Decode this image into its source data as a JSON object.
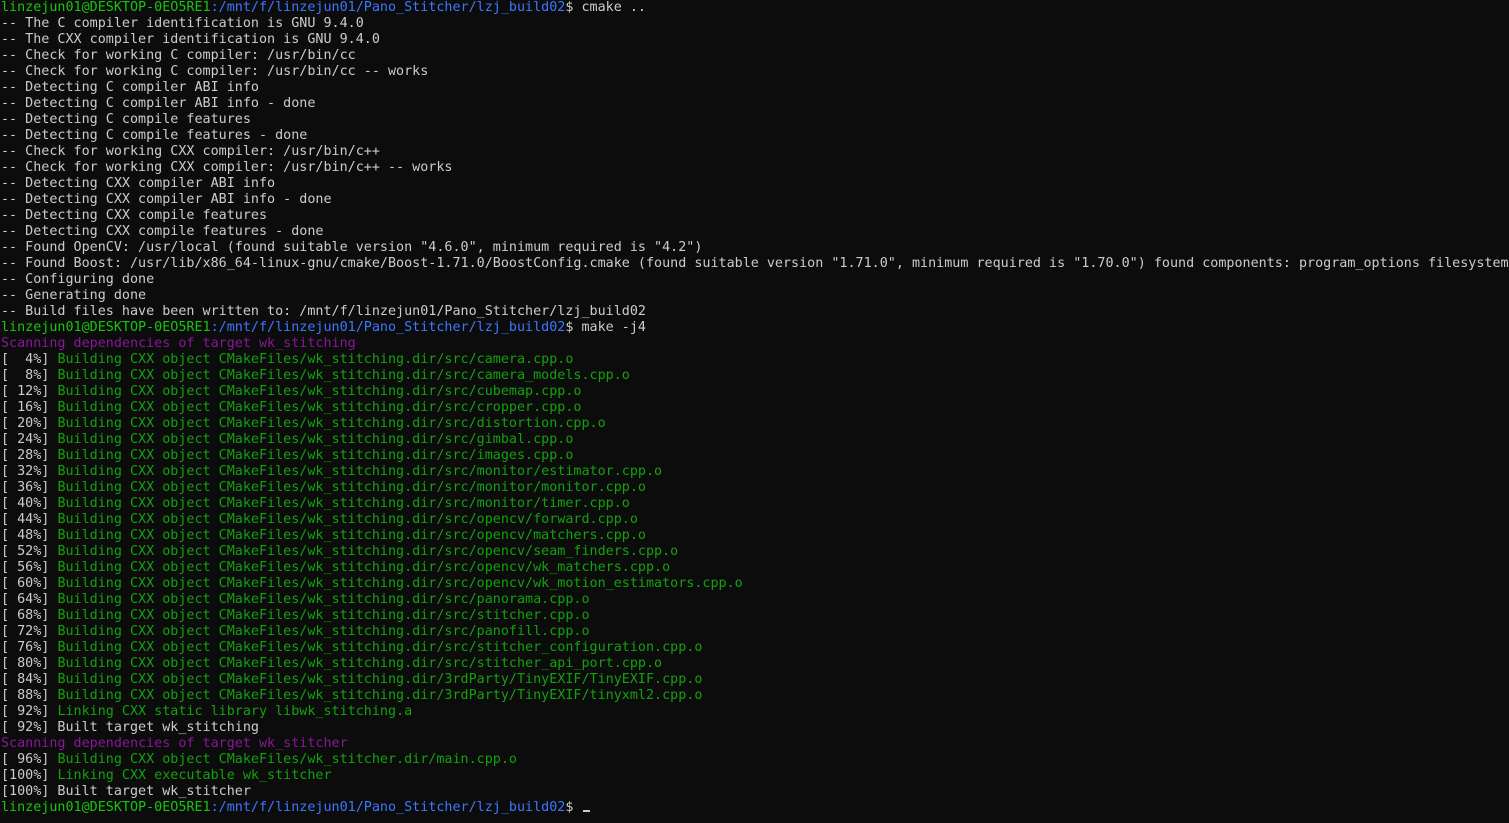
{
  "terminal": {
    "prompt_user": "linzejun01@DESKTOP-0EO5RE1",
    "prompt_path": ":/mnt/f/linzejun01/Pano_Stitcher/lzj_build02",
    "colors": {
      "background": "#0c0c0c",
      "text": "#cccccc",
      "prompt_user": "#16c60c",
      "prompt_path": "#3b78ff",
      "build_green": "#13a10e",
      "scanning_magenta": "#881798"
    },
    "lines": [
      {
        "type": "prompt",
        "user": "linzejun01@DESKTOP-0EO5RE1",
        "path": ":/mnt/f/linzejun01/Pano_Stitcher/lzj_build02",
        "cmd": "$ cmake .."
      },
      {
        "type": "plain",
        "text": "-- The C compiler identification is GNU 9.4.0"
      },
      {
        "type": "plain",
        "text": "-- The CXX compiler identification is GNU 9.4.0"
      },
      {
        "type": "plain",
        "text": "-- Check for working C compiler: /usr/bin/cc"
      },
      {
        "type": "plain",
        "text": "-- Check for working C compiler: /usr/bin/cc -- works"
      },
      {
        "type": "plain",
        "text": "-- Detecting C compiler ABI info"
      },
      {
        "type": "plain",
        "text": "-- Detecting C compiler ABI info - done"
      },
      {
        "type": "plain",
        "text": "-- Detecting C compile features"
      },
      {
        "type": "plain",
        "text": "-- Detecting C compile features - done"
      },
      {
        "type": "plain",
        "text": "-- Check for working CXX compiler: /usr/bin/c++"
      },
      {
        "type": "plain",
        "text": "-- Check for working CXX compiler: /usr/bin/c++ -- works"
      },
      {
        "type": "plain",
        "text": "-- Detecting CXX compiler ABI info"
      },
      {
        "type": "plain",
        "text": "-- Detecting CXX compiler ABI info - done"
      },
      {
        "type": "plain",
        "text": "-- Detecting CXX compile features"
      },
      {
        "type": "plain",
        "text": "-- Detecting CXX compile features - done"
      },
      {
        "type": "plain",
        "text": "-- Found OpenCV: /usr/local (found suitable version \"4.6.0\", minimum required is \"4.2\")"
      },
      {
        "type": "plain",
        "text": "-- Found Boost: /usr/lib/x86_64-linux-gnu/cmake/Boost-1.71.0/BoostConfig.cmake (found suitable version \"1.71.0\", minimum required is \"1.70.0\") found components: program_options filesystem"
      },
      {
        "type": "plain",
        "text": "-- Configuring done"
      },
      {
        "type": "plain",
        "text": "-- Generating done"
      },
      {
        "type": "plain",
        "text": "-- Build files have been written to: /mnt/f/linzejun01/Pano_Stitcher/lzj_build02"
      },
      {
        "type": "prompt",
        "user": "linzejun01@DESKTOP-0EO5RE1",
        "path": ":/mnt/f/linzejun01/Pano_Stitcher/lzj_build02",
        "cmd": "$ make -j4"
      },
      {
        "type": "magenta",
        "text": "Scanning dependencies of target wk_stitching"
      },
      {
        "type": "build",
        "pct": "[  4%] ",
        "text": "Building CXX object CMakeFiles/wk_stitching.dir/src/camera.cpp.o"
      },
      {
        "type": "build",
        "pct": "[  8%] ",
        "text": "Building CXX object CMakeFiles/wk_stitching.dir/src/camera_models.cpp.o"
      },
      {
        "type": "build",
        "pct": "[ 12%] ",
        "text": "Building CXX object CMakeFiles/wk_stitching.dir/src/cubemap.cpp.o"
      },
      {
        "type": "build",
        "pct": "[ 16%] ",
        "text": "Building CXX object CMakeFiles/wk_stitching.dir/src/cropper.cpp.o"
      },
      {
        "type": "build",
        "pct": "[ 20%] ",
        "text": "Building CXX object CMakeFiles/wk_stitching.dir/src/distortion.cpp.o"
      },
      {
        "type": "build",
        "pct": "[ 24%] ",
        "text": "Building CXX object CMakeFiles/wk_stitching.dir/src/gimbal.cpp.o"
      },
      {
        "type": "build",
        "pct": "[ 28%] ",
        "text": "Building CXX object CMakeFiles/wk_stitching.dir/src/images.cpp.o"
      },
      {
        "type": "build",
        "pct": "[ 32%] ",
        "text": "Building CXX object CMakeFiles/wk_stitching.dir/src/monitor/estimator.cpp.o"
      },
      {
        "type": "build",
        "pct": "[ 36%] ",
        "text": "Building CXX object CMakeFiles/wk_stitching.dir/src/monitor/monitor.cpp.o"
      },
      {
        "type": "build",
        "pct": "[ 40%] ",
        "text": "Building CXX object CMakeFiles/wk_stitching.dir/src/monitor/timer.cpp.o"
      },
      {
        "type": "build",
        "pct": "[ 44%] ",
        "text": "Building CXX object CMakeFiles/wk_stitching.dir/src/opencv/forward.cpp.o"
      },
      {
        "type": "build",
        "pct": "[ 48%] ",
        "text": "Building CXX object CMakeFiles/wk_stitching.dir/src/opencv/matchers.cpp.o"
      },
      {
        "type": "build",
        "pct": "[ 52%] ",
        "text": "Building CXX object CMakeFiles/wk_stitching.dir/src/opencv/seam_finders.cpp.o"
      },
      {
        "type": "build",
        "pct": "[ 56%] ",
        "text": "Building CXX object CMakeFiles/wk_stitching.dir/src/opencv/wk_matchers.cpp.o"
      },
      {
        "type": "build",
        "pct": "[ 60%] ",
        "text": "Building CXX object CMakeFiles/wk_stitching.dir/src/opencv/wk_motion_estimators.cpp.o"
      },
      {
        "type": "build",
        "pct": "[ 64%] ",
        "text": "Building CXX object CMakeFiles/wk_stitching.dir/src/panorama.cpp.o"
      },
      {
        "type": "build",
        "pct": "[ 68%] ",
        "text": "Building CXX object CMakeFiles/wk_stitching.dir/src/stitcher.cpp.o"
      },
      {
        "type": "build",
        "pct": "[ 72%] ",
        "text": "Building CXX object CMakeFiles/wk_stitching.dir/src/panofill.cpp.o"
      },
      {
        "type": "build",
        "pct": "[ 76%] ",
        "text": "Building CXX object CMakeFiles/wk_stitching.dir/src/stitcher_configuration.cpp.o"
      },
      {
        "type": "build",
        "pct": "[ 80%] ",
        "text": "Building CXX object CMakeFiles/wk_stitching.dir/src/stitcher_api_port.cpp.o"
      },
      {
        "type": "build",
        "pct": "[ 84%] ",
        "text": "Building CXX object CMakeFiles/wk_stitching.dir/3rdParty/TinyEXIF/TinyEXIF.cpp.o"
      },
      {
        "type": "build",
        "pct": "[ 88%] ",
        "text": "Building CXX object CMakeFiles/wk_stitching.dir/3rdParty/TinyEXIF/tinyxml2.cpp.o"
      },
      {
        "type": "build",
        "pct": "[ 92%] ",
        "text": "Linking CXX static library libwk_stitching.a"
      },
      {
        "type": "plain",
        "text": "[ 92%] Built target wk_stitching"
      },
      {
        "type": "magenta",
        "text": "Scanning dependencies of target wk_stitcher"
      },
      {
        "type": "build",
        "pct": "[ 96%] ",
        "text": "Building CXX object CMakeFiles/wk_stitcher.dir/main.cpp.o"
      },
      {
        "type": "build",
        "pct": "[100%] ",
        "text": "Linking CXX executable wk_stitcher"
      },
      {
        "type": "plain",
        "text": "[100%] Built target wk_stitcher"
      },
      {
        "type": "prompt",
        "user": "linzejun01@DESKTOP-0EO5RE1",
        "path": ":/mnt/f/linzejun01/Pano_Stitcher/lzj_build02",
        "cmd": "$ ",
        "cursor": true
      }
    ]
  }
}
